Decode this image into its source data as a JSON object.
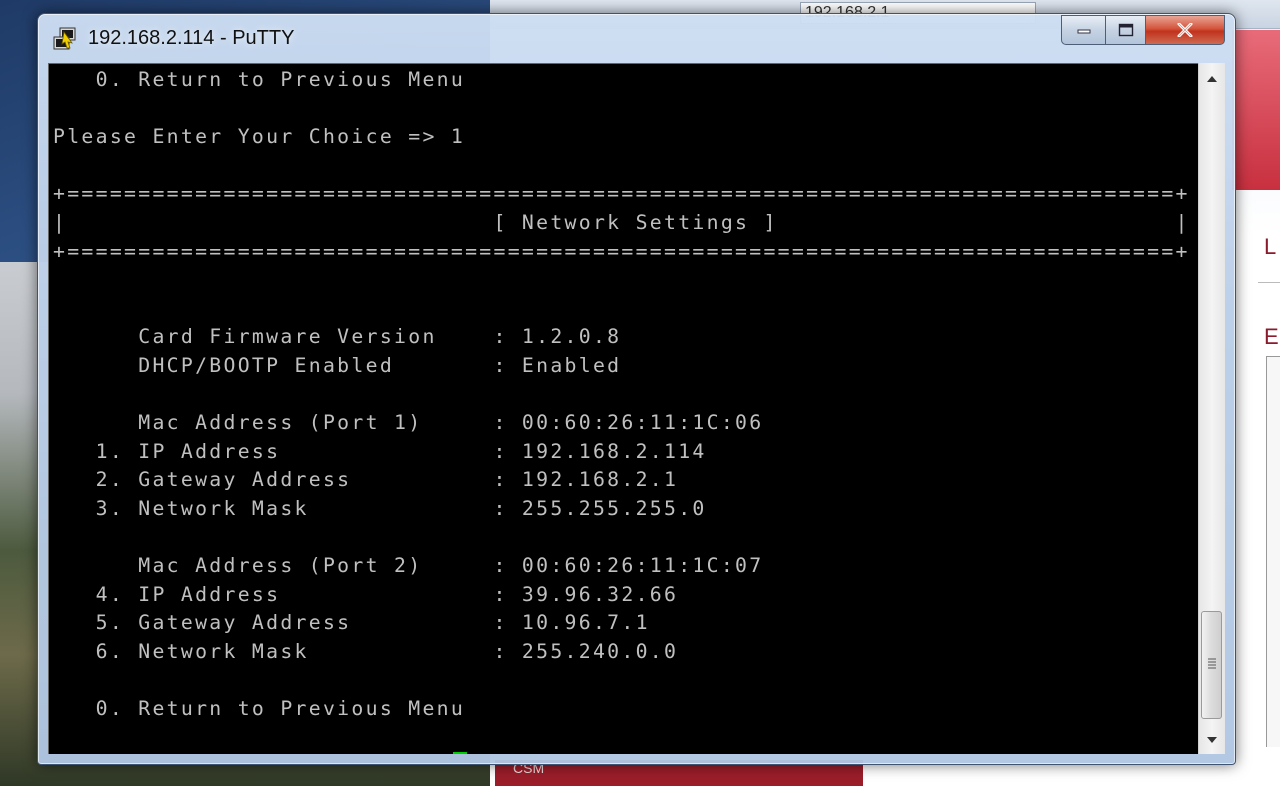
{
  "window": {
    "title": "192.168.2.114 - PuTTY"
  },
  "background": {
    "browser_address": "192.168.2.1",
    "bottom_caption": "CSM",
    "right_fragment_1": "L",
    "right_fragment_2": "E"
  },
  "terminal": {
    "lines": [
      "   0. Return to Previous Menu",
      "",
      "Please Enter Your Choice => 1",
      "",
      "+==============================================================================+",
      "|                              [ Network Settings ]                            |",
      "+==============================================================================+",
      "",
      "",
      "      Card Firmware Version    : 1.2.0.8",
      "      DHCP/BOOTP Enabled       : Enabled",
      "",
      "      Mac Address (Port 1)     : 00:60:26:11:1C:06",
      "   1. IP Address               : 192.168.2.114",
      "   2. Gateway Address          : 192.168.2.1",
      "   3. Network Mask             : 255.255.255.0",
      "",
      "      Mac Address (Port 2)     : 00:60:26:11:1C:07",
      "   4. IP Address               : 39.96.32.66",
      "   5. Gateway Address          : 10.96.7.1",
      "   6. Network Mask             : 255.240.0.0",
      "",
      "   0. Return to Previous Menu",
      ""
    ],
    "prompt": "Please Enter Your Choice => ",
    "cursor_color": "#00d000",
    "text_color": "#c0c0c0",
    "background_color": "#000000"
  },
  "icons": {
    "app": "putty-icon",
    "minimize": "minimize-icon",
    "maximize": "maximize-icon",
    "close": "close-icon",
    "scroll_up": "chevron-up-icon",
    "scroll_down": "chevron-down-icon",
    "thumb_grip": "grip-icon"
  }
}
